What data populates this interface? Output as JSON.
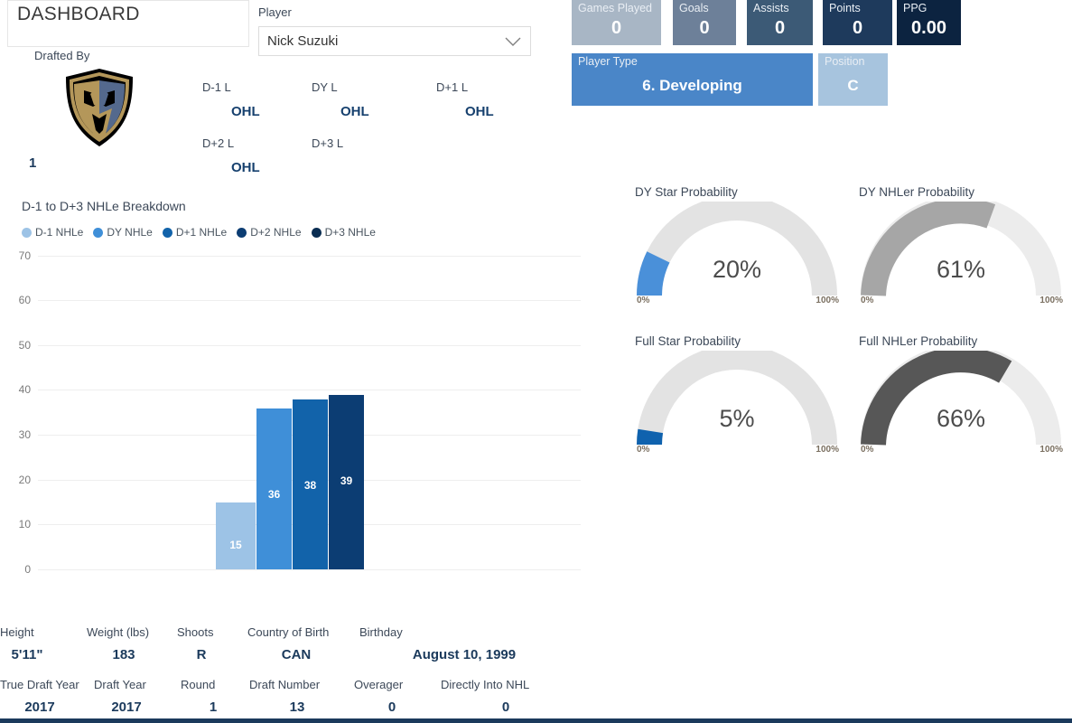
{
  "header": {
    "title": "DASHBOARD",
    "slicer_label": "Player",
    "slicer_value": "Nick Suzuki",
    "chevron_icon": "chevron-down-icon"
  },
  "drafted": {
    "label": "Drafted By",
    "team_logo_icon": "vegas-golden-knights-logo",
    "pick": "1"
  },
  "leagues": [
    {
      "key": "D-1 L",
      "value": "OHL"
    },
    {
      "key": "DY L",
      "value": "OHL"
    },
    {
      "key": "D+1 L",
      "value": "OHL"
    },
    {
      "key": "D+2 L",
      "value": "OHL"
    },
    {
      "key": "D+3 L",
      "value": ""
    }
  ],
  "kpis": [
    {
      "label": "Games Played",
      "value": "0",
      "bg": "#a8b6c5"
    },
    {
      "label": "Goals",
      "value": "0",
      "bg": "#6d8099"
    },
    {
      "label": "Assists",
      "value": "0",
      "bg": "#3c5a76"
    },
    {
      "label": "Points",
      "value": "0",
      "bg": "#1e3a5c"
    },
    {
      "label": "PPG",
      "value": "0.00",
      "bg": "#0c2340"
    }
  ],
  "kpis_wide": [
    {
      "label": "Player Type",
      "value": "6. Developing",
      "bg": "#4a86c8"
    },
    {
      "label": "Position",
      "value": "C",
      "bg": "#a7c4de"
    }
  ],
  "chart_data": {
    "type": "bar",
    "title": "D-1 to D+3 NHLe Breakdown",
    "categories": [
      "D-1 NHLe",
      "DY NHLe",
      "D+1 NHLe",
      "D+2 NHLe",
      "D+3 NHLe"
    ],
    "values": [
      15,
      36,
      38,
      39,
      null
    ],
    "colors": [
      "#9dc3e6",
      "#3f8fd8",
      "#1263aa",
      "#0c3d73",
      "#0a2d52"
    ],
    "ylim": [
      0,
      70
    ],
    "yticks": [
      0,
      10,
      20,
      30,
      40,
      50,
      60,
      70
    ],
    "xlabel": "",
    "ylabel": "",
    "grid": true,
    "legend": [
      "D-1 NHLe",
      "DY NHLe",
      "D+1 NHLe",
      "D+2 NHLe",
      "D+3 NHLe"
    ],
    "legend_position": "top-left"
  },
  "gauges": [
    {
      "title": "DY Star Probability",
      "value": "20%",
      "pct": 20,
      "min": "0%",
      "max": "100%",
      "fill": "#4a90d9",
      "track": "#e3e3e3"
    },
    {
      "title": "DY NHLer Probability",
      "value": "61%",
      "pct": 61,
      "min": "0%",
      "max": "100%",
      "fill": "#a6a6a6",
      "track": "#ececec"
    },
    {
      "title": "Full Star Probability",
      "value": "5%",
      "pct": 5,
      "min": "0%",
      "max": "100%",
      "fill": "#0f62ae",
      "track": "#e3e3e3"
    },
    {
      "title": "Full NHLer Probability",
      "value": "66%",
      "pct": 66,
      "min": "0%",
      "max": "100%",
      "fill": "#575757",
      "track": "#ececec"
    }
  ],
  "bio_row": [
    {
      "key": "Height",
      "value": "5'11\""
    },
    {
      "key": "Weight (lbs)",
      "value": "183"
    },
    {
      "key": "Shoots",
      "value": "R"
    },
    {
      "key": "Country of Birth",
      "value": "CAN"
    },
    {
      "key": "Birthday",
      "value": "August 10, 1999"
    }
  ],
  "draft_row": [
    {
      "key": "True Draft Year",
      "value": "2017"
    },
    {
      "key": "Draft Year",
      "value": "2017"
    },
    {
      "key": "Round",
      "value": "1"
    },
    {
      "key": "Draft Number",
      "value": "13"
    },
    {
      "key": "Overager",
      "value": "0"
    },
    {
      "key": "Directly Into NHL",
      "value": "0"
    }
  ]
}
